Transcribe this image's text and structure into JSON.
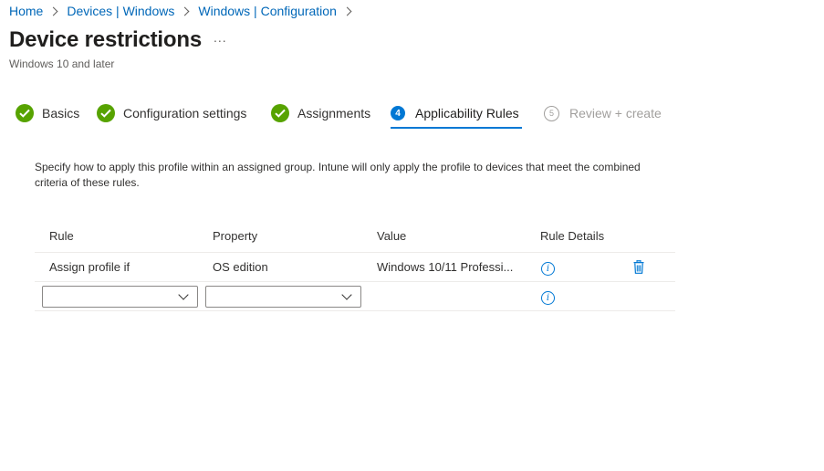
{
  "breadcrumb": {
    "items": [
      "Home",
      "Devices | Windows",
      "Windows | Configuration"
    ]
  },
  "header": {
    "title": "Device restrictions",
    "more_label": "...",
    "subtitle": "Windows 10 and later"
  },
  "wizard": {
    "steps": [
      {
        "label": "Basics",
        "status": "complete"
      },
      {
        "label": "Configuration settings",
        "status": "complete"
      },
      {
        "label": "Assignments",
        "status": "complete"
      },
      {
        "label": "Applicability Rules",
        "number": "4",
        "status": "active"
      },
      {
        "label": "Review + create",
        "number": "5",
        "status": "pending"
      }
    ]
  },
  "main": {
    "description": "Specify how to apply this profile within an assigned group. Intune will only apply the profile to devices that meet the combined criteria of these rules."
  },
  "rules_table": {
    "columns": [
      "Rule",
      "Property",
      "Value",
      "Rule Details"
    ],
    "rows": [
      {
        "rule": "Assign profile if",
        "property": "OS edition",
        "value": "Windows 10/11 Professi..."
      }
    ],
    "new_row": {
      "rule_selected": "",
      "property_selected": ""
    }
  },
  "colors": {
    "accent": "#0078d4",
    "success": "#57a300",
    "link": "#0067b8"
  },
  "icons": {
    "complete_step": "check-circle-icon",
    "info": "info-icon",
    "delete": "trash-icon",
    "dropdown": "chevron-down-icon",
    "breadcrumb_separator": "chevron-right-icon"
  }
}
